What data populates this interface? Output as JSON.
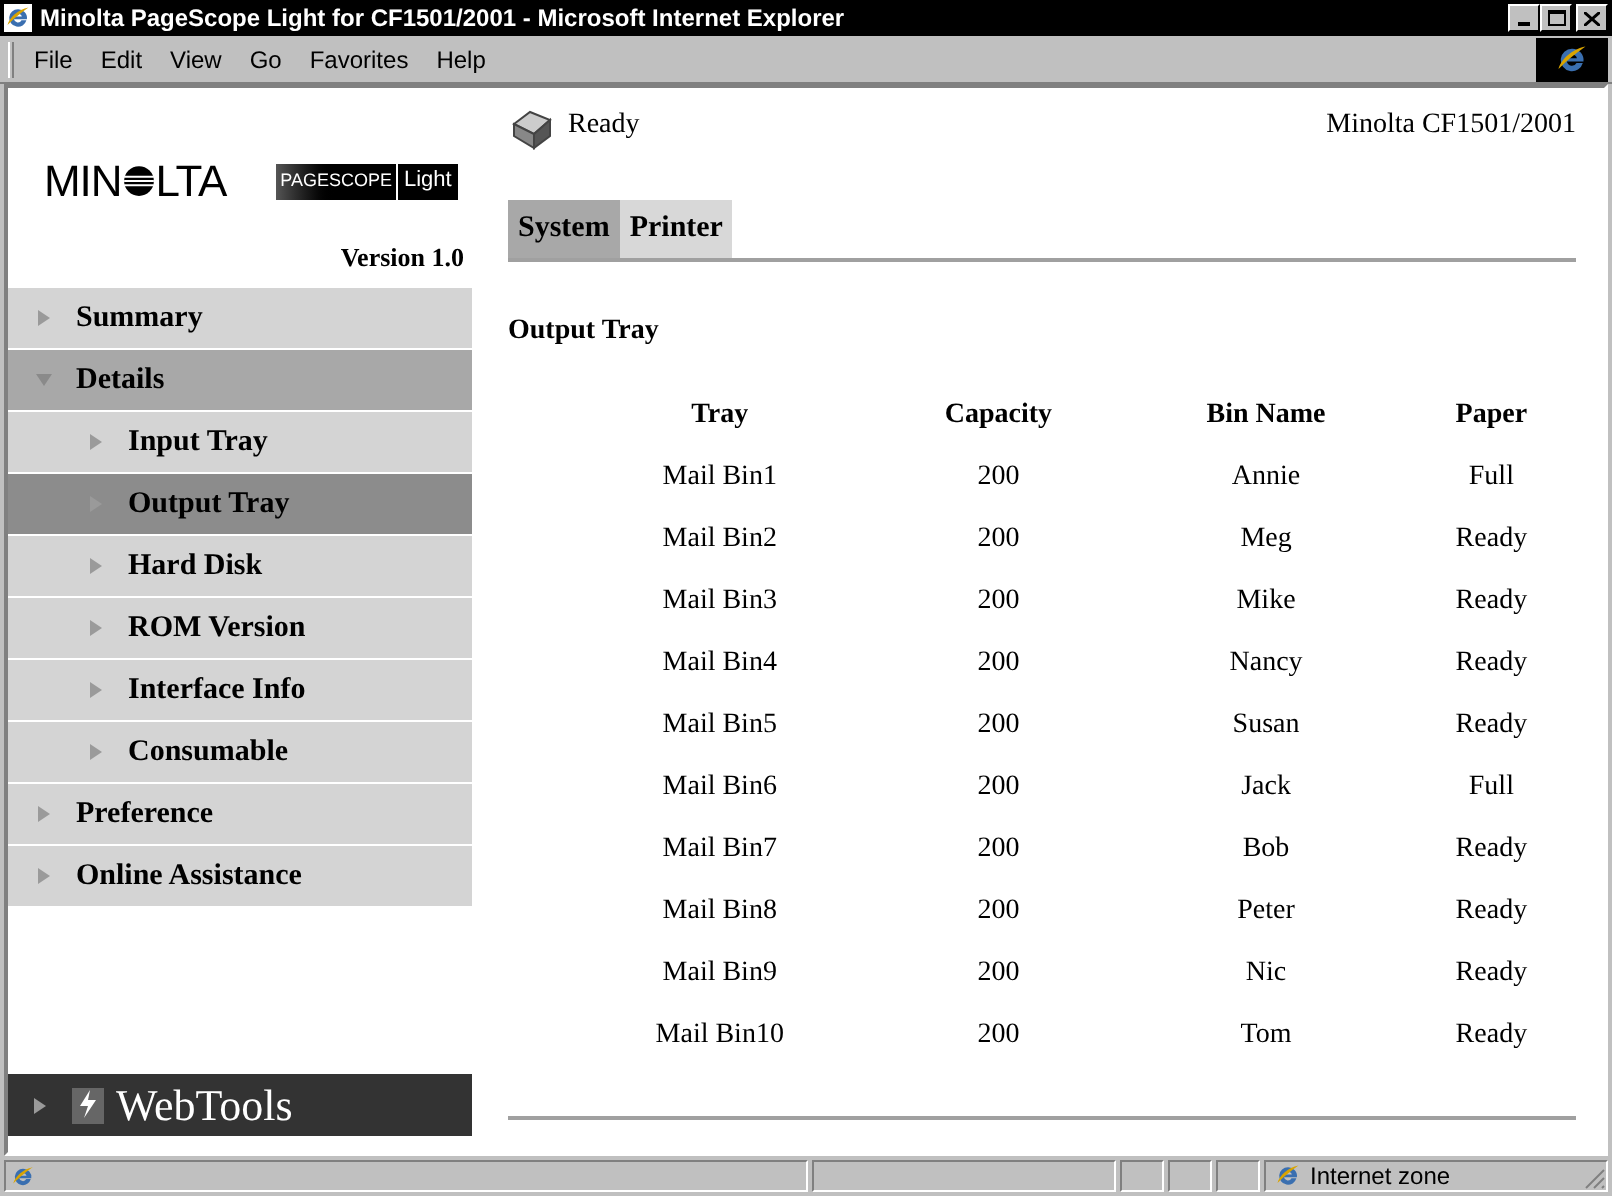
{
  "window": {
    "title": "Minolta PageScope Light for CF1501/2001 - Microsoft Internet Explorer"
  },
  "menu": [
    "File",
    "Edit",
    "View",
    "Go",
    "Favorites",
    "Help"
  ],
  "logo": {
    "left": "MIN",
    "right": "LTA",
    "badge": "PAGESCOPE",
    "badge_suffix": "Light",
    "version": "Version 1.0"
  },
  "sidebar": {
    "items": [
      {
        "label": "Summary",
        "expanded": false,
        "selected": false
      },
      {
        "label": "Details",
        "expanded": true,
        "selected": false,
        "children": [
          {
            "label": "Input Tray",
            "selected": false
          },
          {
            "label": "Output Tray",
            "selected": true
          },
          {
            "label": "Hard Disk",
            "selected": false
          },
          {
            "label": "ROM Version",
            "selected": false
          },
          {
            "label": "Interface Info",
            "selected": false
          },
          {
            "label": "Consumable",
            "selected": false
          }
        ]
      },
      {
        "label": "Preference",
        "expanded": false,
        "selected": false
      },
      {
        "label": "Online Assistance",
        "expanded": false,
        "selected": false
      }
    ],
    "footer": "WebTools"
  },
  "status": {
    "text": "Ready",
    "model": "Minolta CF1501/2001"
  },
  "tabs": [
    {
      "label": "System",
      "selected": true
    },
    {
      "label": "Printer",
      "selected": false
    }
  ],
  "section_title": "Output Tray",
  "table": {
    "columns": [
      "Tray",
      "Capacity",
      "Bin Name",
      "Paper"
    ],
    "rows": [
      [
        "Mail Bin1",
        "200",
        "Annie",
        "Full"
      ],
      [
        "Mail Bin2",
        "200",
        "Meg",
        "Ready"
      ],
      [
        "Mail Bin3",
        "200",
        "Mike",
        "Ready"
      ],
      [
        "Mail Bin4",
        "200",
        "Nancy",
        "Ready"
      ],
      [
        "Mail Bin5",
        "200",
        "Susan",
        "Ready"
      ],
      [
        "Mail Bin6",
        "200",
        "Jack",
        "Full"
      ],
      [
        "Mail Bin7",
        "200",
        "Bob",
        "Ready"
      ],
      [
        "Mail Bin8",
        "200",
        "Peter",
        "Ready"
      ],
      [
        "Mail Bin9",
        "200",
        "Nic",
        "Ready"
      ],
      [
        "Mail Bin10",
        "200",
        "Tom",
        "Ready"
      ]
    ]
  },
  "status_bar": {
    "zone": "Internet zone"
  }
}
